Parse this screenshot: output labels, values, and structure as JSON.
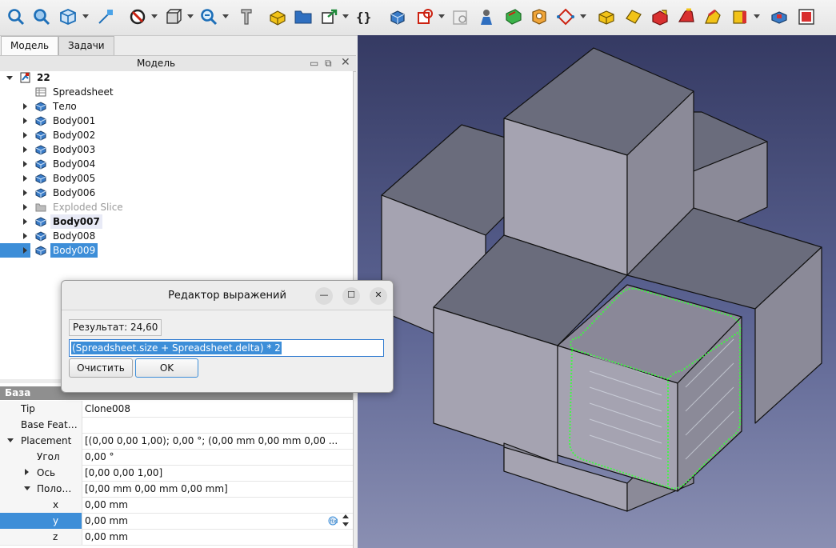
{
  "toolbar": {
    "icons": [
      "fit-all-icon",
      "fit-selection-icon",
      "view-cube-icon",
      "std-measure-icon",
      "draw-style-icon",
      "bounding-box-icon",
      "zoom-icon",
      "measure-distance-icon",
      "part-icon",
      "folder-icon",
      "link-icon",
      "expression-icon",
      "body-icon",
      "sketch-icon",
      "validate-sketch-icon",
      "attach-icon",
      "pad-icon",
      "pocket-icon",
      "datum-icon",
      "additive-box-icon",
      "additive-cylinder-icon",
      "subtractive-box-icon",
      "fillet-icon",
      "chamfer-icon",
      "thickness-icon",
      "pattern-icon",
      "mirror-icon"
    ]
  },
  "tabs": [
    {
      "label": "Модель"
    },
    {
      "label": "Задачи"
    }
  ],
  "panel": {
    "title": "Модель"
  },
  "tree": {
    "root": "22",
    "items": [
      {
        "label": "Spreadsheet",
        "icon": "spreadsheet-icon"
      },
      {
        "label": "Тело",
        "icon": "body-icon"
      },
      {
        "label": "Body001",
        "icon": "body-icon"
      },
      {
        "label": "Body002",
        "icon": "body-icon"
      },
      {
        "label": "Body003",
        "icon": "body-icon"
      },
      {
        "label": "Body004",
        "icon": "body-icon"
      },
      {
        "label": "Body005",
        "icon": "body-icon"
      },
      {
        "label": "Body006",
        "icon": "body-icon"
      },
      {
        "label": "Exploded Slice",
        "icon": "folder-icon"
      },
      {
        "label": "Body007",
        "icon": "body-icon"
      },
      {
        "label": "Body008",
        "icon": "body-icon"
      },
      {
        "label": "Body009",
        "icon": "body-icon"
      }
    ]
  },
  "properties": {
    "group": "База",
    "rows": [
      {
        "key": "Tip",
        "value": "Clone008"
      },
      {
        "key": "Base Feat…",
        "value": ""
      },
      {
        "key": "Placement",
        "value": "[(0,00 0,00 1,00); 0,00 °; (0,00 mm  0,00 mm  0,00 ..."
      },
      {
        "key": "Угол",
        "value": "0,00 °"
      },
      {
        "key": "Ось",
        "value": "[0,00 0,00 1,00]"
      },
      {
        "key": "Поло…",
        "value": "[0,00 mm  0,00 mm  0,00 mm]"
      },
      {
        "key": "x",
        "value": "0,00 mm"
      },
      {
        "key": "y",
        "value": "0,00 mm"
      },
      {
        "key": "z",
        "value": "0,00 mm"
      }
    ]
  },
  "dialog": {
    "title": "Редактор выражений",
    "result": "Результат: 24,60",
    "expression": "(Spreadsheet.size + Spreadsheet.delta) * 2",
    "clear_label": "Очистить",
    "ok_label": "OK"
  },
  "colors": {
    "selection": "#3d8ed8",
    "viewport_top": "#353a63",
    "viewport_bottom": "#8a8fb2",
    "highlight_green": "#39ff3c"
  }
}
